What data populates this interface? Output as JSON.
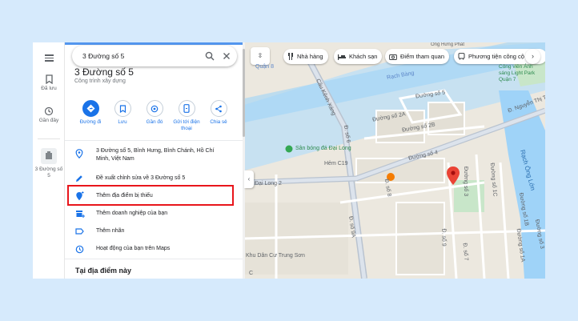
{
  "rail": {
    "saved_label": "Đã lưu",
    "recent_label": "Gần đây",
    "recent_place_label": "3 Đường số 5"
  },
  "search": {
    "query": "3 Đường số 5"
  },
  "place": {
    "title": "3 Đường số 5",
    "type": "Công trình xây dựng"
  },
  "actions": [
    {
      "label": "Đường đi",
      "icon": "directions-icon"
    },
    {
      "label": "Lưu",
      "icon": "bookmark-icon"
    },
    {
      "label": "Gần đó",
      "icon": "nearby-icon"
    },
    {
      "label": "Gửi tới điện thoại",
      "icon": "phone-icon"
    },
    {
      "label": "Chia sẻ",
      "icon": "share-icon"
    }
  ],
  "details": [
    {
      "text": "3 Đường số 5, Bình Hưng, Bình Chánh, Hồ Chí Minh, Việt Nam",
      "icon": "location-pin-icon"
    },
    {
      "text": "Đề xuất chỉnh sửa về 3 Đường số 5",
      "icon": "edit-pencil-icon"
    },
    {
      "text": "Thêm địa điểm bị thiếu",
      "icon": "add-place-icon"
    },
    {
      "text": "Thêm doanh nghiệp của bạn",
      "icon": "add-business-icon"
    },
    {
      "text": "Thêm nhãn",
      "icon": "label-icon"
    },
    {
      "text": "Hoạt động của bạn trên Maps",
      "icon": "history-icon"
    }
  ],
  "section_heading": "Tại địa điểm này",
  "chips": [
    {
      "label": "Nhà hàng",
      "icon": "restaurant-icon"
    },
    {
      "label": "Khách sạn",
      "icon": "hotel-icon"
    },
    {
      "label": "Điểm tham quan",
      "icon": "camera-icon"
    },
    {
      "label": "Phương tiện công cộ",
      "icon": "transit-icon"
    }
  ],
  "map_labels": {
    "rach_bang": "Rạch Bàng",
    "rach_ong_lon": "Rạch Ông Lớn",
    "kenh_xang": "Cầu Kênh Xáng",
    "duong_so_5": "Đường số 5",
    "duong_so_2a": "Đường số 2A",
    "duong_so_2b": "Đường số 2B",
    "duong_so_4": "Đường số 4",
    "duong_so_3": "Đường số 3",
    "duong_so_1c": "Đường số 1C",
    "duong_so_1b": "Đường số 1B",
    "duong_so_1a": "Đường số 1A",
    "duong_so_3_side": "Đường số 3",
    "nguyen_thi_thap": "Đ. Nguyễn Thị Thập",
    "d_so_9a": "Đ. số 9A",
    "d_so_6": "Đ. số 6",
    "d_so_8": "Đ. số 8",
    "d_so_7": "Đ. số 7",
    "d_so_9": "Đ. số 9",
    "hem": "Hẻm C19",
    "san_bong": "Sân bóng đá Đại Long",
    "dai_long": "Đại Long 2",
    "khu_dan_cu": "Khu Dân Cư Trung Sơn",
    "cong_vien": "Công viên Ánh sáng Light Park Quận 7",
    "top_label": "Ông Hưng Phát",
    "quan": "Quận 8",
    "c": "C"
  }
}
